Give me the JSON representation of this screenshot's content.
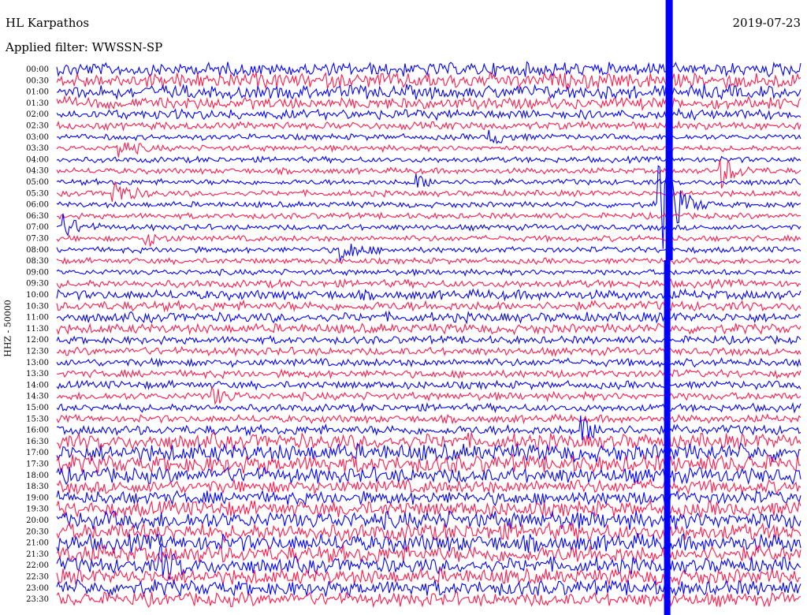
{
  "header": {
    "station": "HL Karpathos",
    "date": "2019-07-23",
    "filter": "Applied filter: WWSSN-SP"
  },
  "chart_data": {
    "type": "line",
    "title": "HL Karpathos",
    "ylabel": "HHZ - 50000",
    "y_ticks": [
      "00:00",
      "00:30",
      "01:00",
      "01:30",
      "02:00",
      "02:30",
      "03:00",
      "03:30",
      "04:00",
      "04:30",
      "05:00",
      "05:30",
      "06:00",
      "06:30",
      "07:00",
      "07:30",
      "08:00",
      "08:30",
      "09:00",
      "09:30",
      "10:00",
      "10:30",
      "11:00",
      "11:30",
      "12:00",
      "12:30",
      "13:00",
      "13:30",
      "14:00",
      "14:30",
      "15:00",
      "15:30",
      "16:00",
      "16:30",
      "17:00",
      "17:30",
      "18:00",
      "18:30",
      "19:00",
      "19:30",
      "20:00",
      "20:30",
      "21:00",
      "21:30",
      "22:00",
      "22:30",
      "23:00",
      "23:30"
    ],
    "x_range_minutes": [
      0,
      30
    ],
    "colors": {
      "odd_trace": "#ff1a4a",
      "even_trace": "#0000ff"
    },
    "noise_level_per_line": [
      7,
      8,
      7,
      6,
      5,
      4,
      3,
      3,
      3,
      3,
      3,
      3,
      3,
      3,
      3,
      3,
      3,
      3,
      3,
      4,
      5,
      5,
      5,
      5,
      4,
      4,
      4,
      4,
      4,
      4,
      4,
      4,
      5,
      8,
      9,
      9,
      8,
      7,
      7,
      8,
      9,
      9,
      9,
      9,
      8,
      8,
      8,
      7
    ],
    "events": [
      {
        "hour": "03:30",
        "minute": 2.5,
        "amp": 12
      },
      {
        "hour": "05:30",
        "minute": 2.3,
        "amp": 18
      },
      {
        "hour": "07:00",
        "minute": 0.3,
        "amp": 14
      },
      {
        "hour": "07:30",
        "minute": 3.5,
        "amp": 10
      },
      {
        "hour": "08:00",
        "minute": 11.5,
        "amp": 16
      },
      {
        "hour": "04:30",
        "minute": 26.8,
        "amp": 20
      },
      {
        "hour": "06:00",
        "minute": 24.3,
        "amp": 80
      },
      {
        "hour": "05:00",
        "minute": 14.4,
        "amp": 10
      },
      {
        "hour": "03:00",
        "minute": 17.5,
        "amp": 10
      },
      {
        "hour": "14:30",
        "minute": 6.3,
        "amp": 10
      },
      {
        "hour": "16:00",
        "minute": 21.2,
        "amp": 15
      },
      {
        "hour": "22:00",
        "minute": 4.2,
        "amp": 20
      }
    ]
  }
}
